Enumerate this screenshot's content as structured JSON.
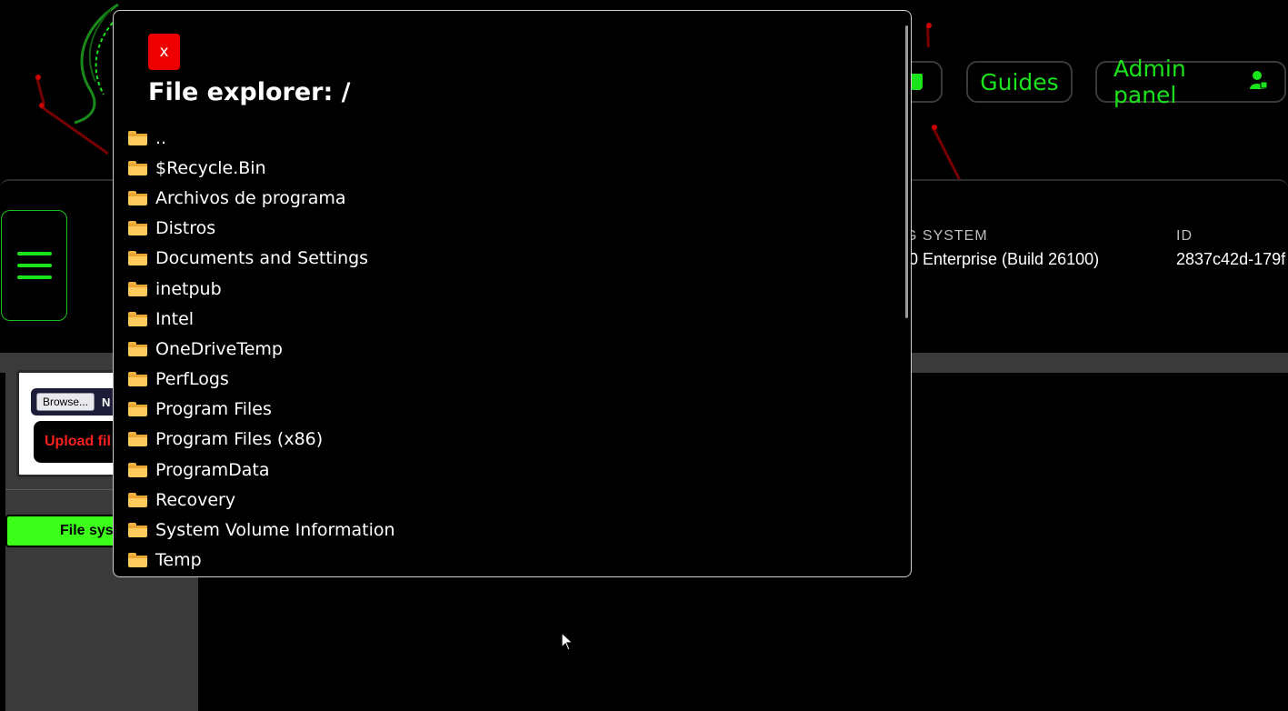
{
  "nav": {
    "guides_label": "Guides",
    "admin_label": "Admin panel"
  },
  "system_info": {
    "os_label": "G SYSTEM",
    "os_value": "0 Enterprise (Build 26100)",
    "id_label": "ID",
    "id_value": "2837c42d-179f"
  },
  "sidebar": {
    "browse_label": "Browse...",
    "file_status": "N",
    "upload_label": "Upload fil",
    "filesystem_label": "File sys"
  },
  "modal": {
    "close_label": "x",
    "title": "File explorer: /",
    "entries": [
      "..",
      "$Recycle.Bin",
      "Archivos de programa",
      "Distros",
      "Documents and Settings",
      "inetpub",
      "Intel",
      "OneDriveTemp",
      "PerfLogs",
      "Program Files",
      "Program Files (x86)",
      "ProgramData",
      "Recovery",
      "System Volume Information",
      "Temp"
    ],
    "entry_icon": "folder-icon"
  },
  "colors": {
    "accent": "#1be31b",
    "close": "#ee0000",
    "folder": "#ffcb5c",
    "filesystem_button": "#3cff1a"
  }
}
